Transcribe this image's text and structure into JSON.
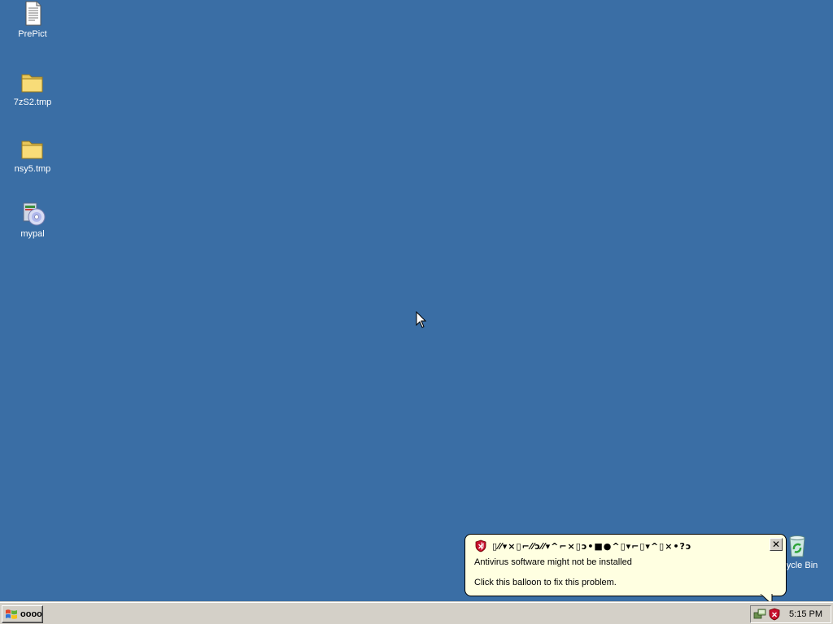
{
  "desktop": {
    "icons": [
      {
        "label": "PrePict",
        "icon": "text-document-icon"
      },
      {
        "label": "7zS2.tmp",
        "icon": "folder-icon"
      },
      {
        "label": "nsy5.tmp",
        "icon": "folder-icon"
      },
      {
        "label": "mypal",
        "icon": "installer-cd-icon"
      },
      {
        "label": "ycle Bin",
        "icon": "recycle-bin-icon"
      }
    ],
    "background_color": "#3a6ea5"
  },
  "balloon": {
    "title": "▯⁄⁄▾×▯⌐⁄⁄ↄ⁄⁄▾^⌐×▯ↄ•■●^▯▾⌐▯▾^▯×•?ↄ",
    "message_line1": "Antivirus software might not be installed",
    "message_line2": "Click this balloon to fix this problem.",
    "close_label": "✕",
    "icon": "security-shield-icon",
    "background_color": "#ffffe1"
  },
  "taskbar": {
    "start_label": "oooo",
    "tray_icons": [
      "network-icon",
      "security-shield-icon"
    ],
    "clock": "5:15 PM",
    "background_color": "#d4d0c8"
  }
}
